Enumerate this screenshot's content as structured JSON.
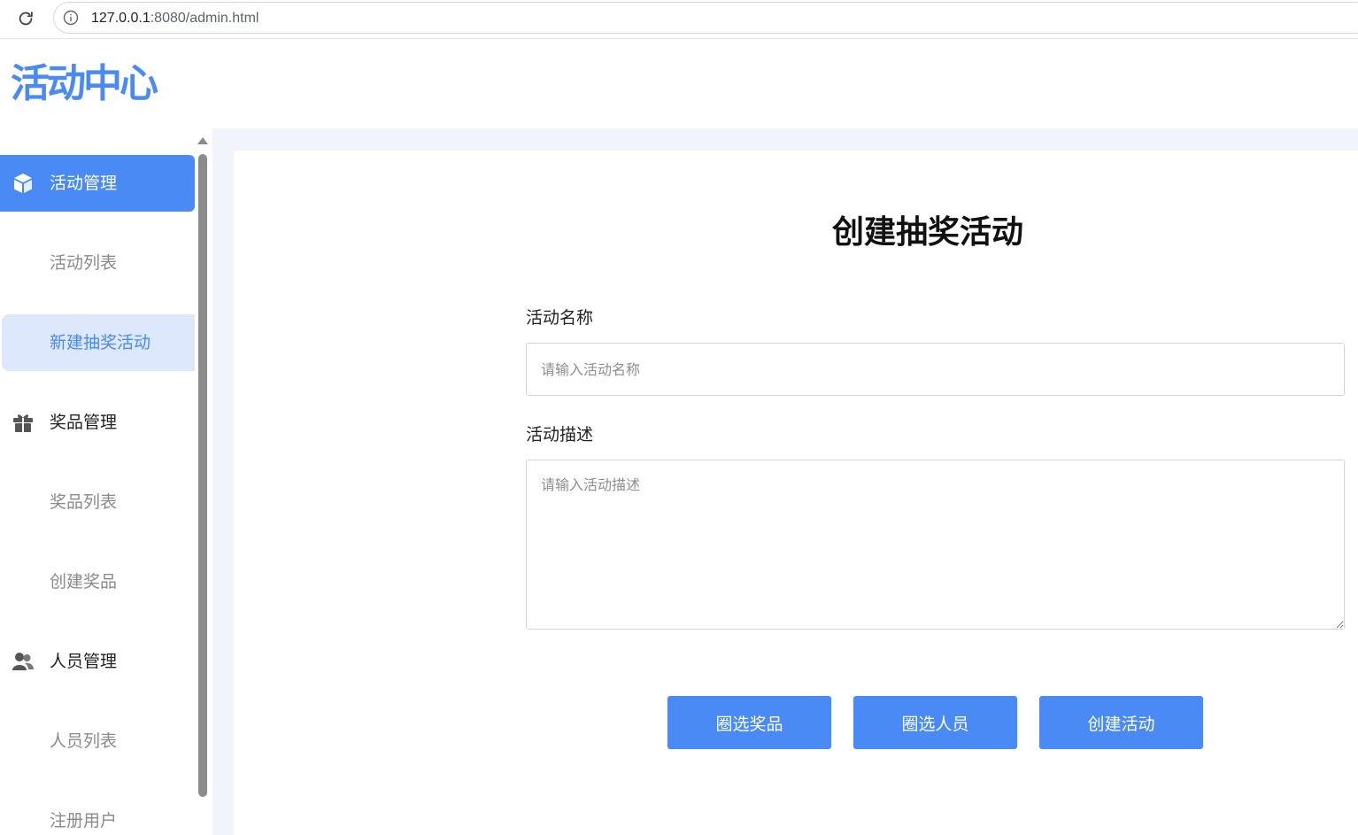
{
  "browser": {
    "url_host": "127.0.0.1",
    "url_rest": ":8080/admin.html"
  },
  "header": {
    "logo": "活动中心"
  },
  "sidebar": {
    "groups": [
      {
        "label": "活动管理",
        "icon": "cube-icon",
        "active": true,
        "items": [
          {
            "label": "活动列表"
          },
          {
            "label": "新建抽奖活动",
            "selected": true
          }
        ]
      },
      {
        "label": "奖品管理",
        "icon": "gift-icon",
        "items": [
          {
            "label": "奖品列表"
          },
          {
            "label": "创建奖品"
          }
        ]
      },
      {
        "label": "人员管理",
        "icon": "users-icon",
        "items": [
          {
            "label": "人员列表"
          },
          {
            "label": "注册用户"
          }
        ]
      }
    ]
  },
  "main": {
    "title": "创建抽奖活动",
    "name_label": "活动名称",
    "name_placeholder": "请输入活动名称",
    "desc_label": "活动描述",
    "desc_placeholder": "请输入活动描述",
    "buttons": {
      "select_prizes": "圈选奖品",
      "select_people": "圈选人员",
      "create": "创建活动"
    }
  },
  "colors": {
    "accent": "#4a8af4",
    "selected_bg": "#dde8fc",
    "page_bg": "#f1f5fb"
  }
}
